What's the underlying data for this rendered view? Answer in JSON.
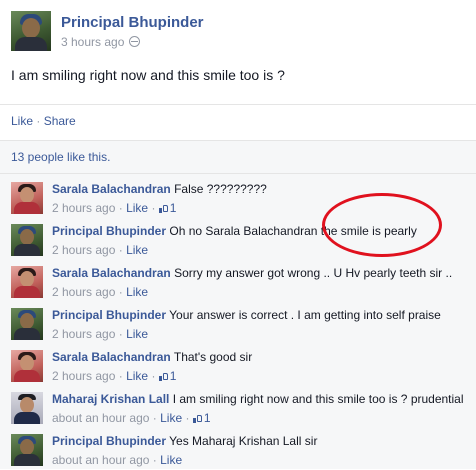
{
  "post": {
    "author": "Principal Bhupinder",
    "time": "3 hours ago",
    "text": "I am smiling right now and this smile too is ?",
    "actions": {
      "like": "Like",
      "separator": "·",
      "share": "Share"
    },
    "likes_summary": "13 people like this."
  },
  "comments": [
    {
      "author": "Sarala Balachandran",
      "text": "False ?????????",
      "time": "2 hours ago",
      "like": "Like",
      "likes": "1"
    },
    {
      "author": "Principal Bhupinder",
      "text": "Oh no Sarala Balachandran the smile is pearly",
      "time": "2 hours ago",
      "like": "Like",
      "likes": ""
    },
    {
      "author": "Sarala Balachandran",
      "text": "Sorry my answer got wrong .. U Hv pearly teeth sir ..",
      "time": "2 hours ago",
      "like": "Like",
      "likes": ""
    },
    {
      "author": "Principal Bhupinder",
      "text": "Your answer is correct . I am getting into self praise",
      "time": "2 hours ago",
      "like": "Like",
      "likes": ""
    },
    {
      "author": "Sarala Balachandran",
      "text": "That's good sir",
      "time": "2 hours ago",
      "like": "Like",
      "likes": "1"
    },
    {
      "author": "Maharaj Krishan Lall",
      "text": "I am smiling right now and this smile too is ? prudential",
      "time": "about an hour ago",
      "like": "Like",
      "likes": "1"
    },
    {
      "author": "Principal Bhupinder",
      "text": "Yes Maharaj Krishan Lall sir",
      "time": "about an hour ago",
      "like": "Like",
      "likes": ""
    }
  ],
  "icons": {
    "privacy": "globe-icon",
    "like_count": "thumbs-up-icon"
  },
  "colors": {
    "link": "#3b5998",
    "meta": "#9197a3",
    "annotation": "#e0111e",
    "comment_bg": "#f6f7f8"
  }
}
